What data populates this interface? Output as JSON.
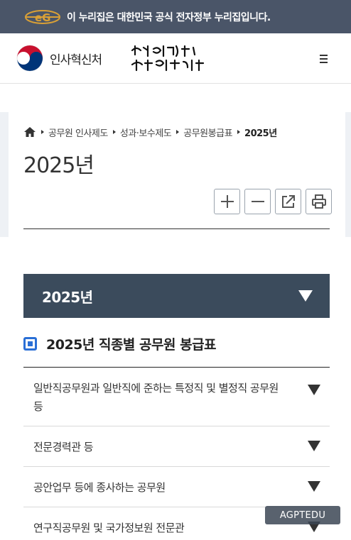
{
  "gov_banner": {
    "text": "이 누리집은 대한민국 공식 전자정부 누리집입니다.",
    "logo_icon": "egovernment-logo-icon",
    "background": "#4a5568",
    "logo_color": "#d9a036"
  },
  "header": {
    "org_name": "인사혁신처",
    "emblem_icon": "taegeuk-emblem-icon",
    "slogan_icon": "slogan-handwriting-icon",
    "menu_icon": "hamburger-menu-icon"
  },
  "breadcrumb": {
    "home_icon": "home-icon",
    "items": [
      "공무원 인사제도",
      "성과·보수제도",
      "공무원봉급표",
      "2025년"
    ]
  },
  "page_title": "2025년",
  "tools": [
    {
      "name": "zoom-in-button",
      "icon": "plus-icon"
    },
    {
      "name": "zoom-out-button",
      "icon": "minus-icon"
    },
    {
      "name": "share-button",
      "icon": "share-icon"
    },
    {
      "name": "print-button",
      "icon": "printer-icon"
    }
  ],
  "accordion": {
    "title": "2025년",
    "arrow_icon": "triangle-down-icon",
    "background": "#3b4b5c"
  },
  "section": {
    "title": "2025년 직종별 공무원 봉급표",
    "bullet_color": "#2a6fd6"
  },
  "list": [
    {
      "label": "일반직공무원과 일반직에 준하는 특정직 및 별정직 공무원 등"
    },
    {
      "label": "전문경력관 등"
    },
    {
      "label": "공안업무 등에 종사하는 공무원"
    },
    {
      "label": "연구직공무원 및 국가정보원 전문관"
    }
  ],
  "watermark": "AGPTEDU"
}
